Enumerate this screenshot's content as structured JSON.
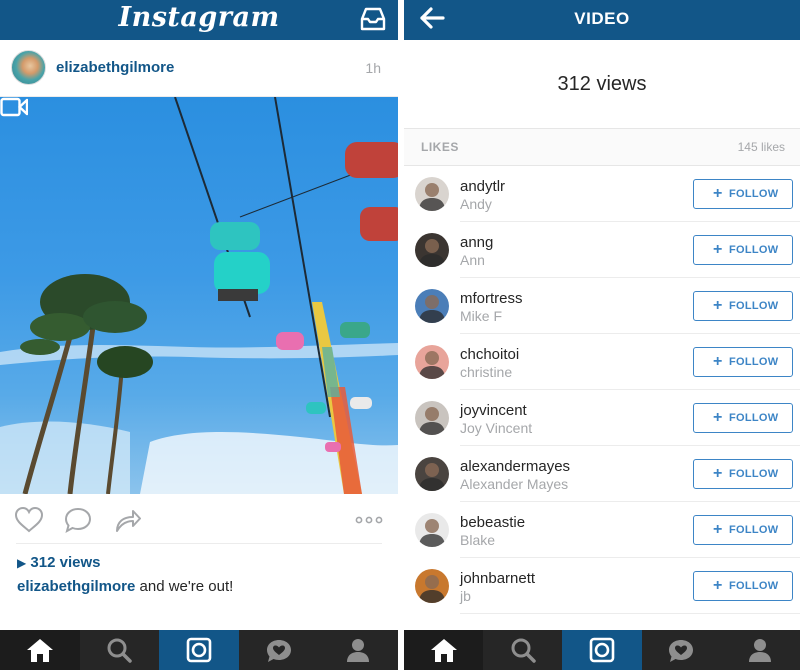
{
  "left": {
    "header": {
      "logo": "Instagram"
    },
    "post": {
      "username": "elizabethgilmore",
      "time": "1h",
      "views": "312 views",
      "caption_user": "elizabethgilmore",
      "caption_text": " and we're out!"
    }
  },
  "right": {
    "header": {
      "title": "VIDEO"
    },
    "views": "312 views",
    "likes_label": "LIKES",
    "likes_count": "145 likes",
    "follow_label": "FOLLOW",
    "likers": [
      {
        "username": "andytlr",
        "fullname": "Andy",
        "avatar_color": "#d9d4cf"
      },
      {
        "username": "anng",
        "fullname": "Ann",
        "avatar_color": "#3b3531"
      },
      {
        "username": "mfortress",
        "fullname": "Mike F",
        "avatar_color": "#4b7eb8"
      },
      {
        "username": "chchoitoi",
        "fullname": "christine",
        "avatar_color": "#e8a49a"
      },
      {
        "username": "joyvincent",
        "fullname": "Joy Vincent",
        "avatar_color": "#c9c4bf"
      },
      {
        "username": "alexandermayes",
        "fullname": "Alexander Mayes",
        "avatar_color": "#4a4440"
      },
      {
        "username": "bebeastie",
        "fullname": "Blake",
        "avatar_color": "#e9e9e9"
      },
      {
        "username": "johnbarnett",
        "fullname": "jb",
        "avatar_color": "#c8782e"
      }
    ]
  },
  "colors": {
    "brand": "#125688",
    "follow": "#3d85c6",
    "nav": "#262626",
    "muted": "#a5a7aa"
  },
  "icons": [
    "inbox-icon",
    "back-arrow-icon",
    "video-camera-icon",
    "heart-icon",
    "comment-icon",
    "share-icon",
    "more-icon",
    "home-icon",
    "search-icon",
    "camera-icon",
    "activity-icon",
    "profile-icon",
    "play-icon",
    "plus-icon"
  ]
}
